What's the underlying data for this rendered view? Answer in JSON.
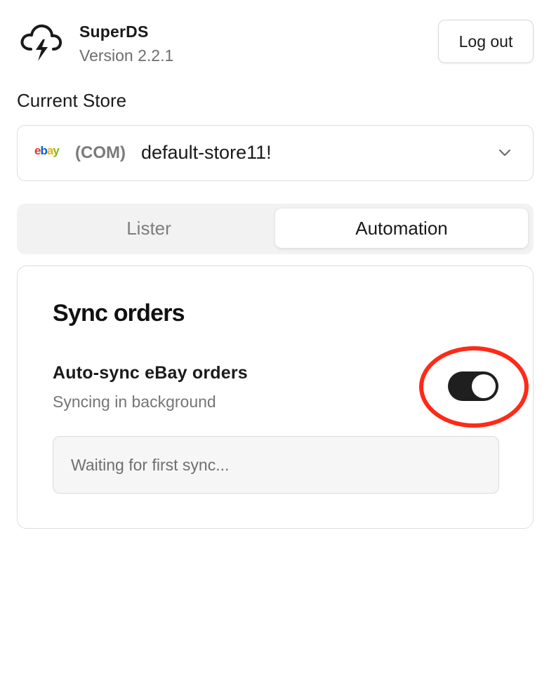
{
  "header": {
    "app_name": "SuperDS",
    "version": "Version 2.2.1",
    "logout_label": "Log out",
    "logo_icon": "storm-cloud-icon"
  },
  "store": {
    "label": "Current Store",
    "platform_logo": "ebay",
    "marketplace": "(COM)",
    "name": "default-store11!",
    "dropdown_icon": "chevron-down-icon"
  },
  "tabs": [
    {
      "label": "Lister",
      "active": false
    },
    {
      "label": "Automation",
      "active": true
    }
  ],
  "sync": {
    "title": "Sync orders",
    "setting_title": "Auto-sync eBay orders",
    "setting_subtitle": "Syncing in background",
    "toggle_on": true,
    "status": "Waiting for first sync..."
  },
  "colors": {
    "highlight_ring": "#ff2a17",
    "toggle_on": "#1f1f1f",
    "accent_text": "#1a1a1a",
    "muted_text": "#757575"
  }
}
